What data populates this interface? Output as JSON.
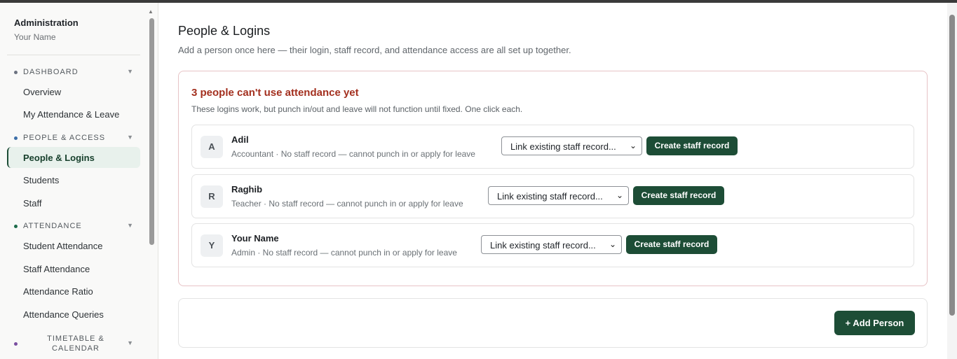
{
  "sidebar": {
    "title": "Administration",
    "user": "Your Name",
    "sections": [
      {
        "label": "DASHBOARD",
        "color": "#6b7280",
        "items": [
          "Overview",
          "My Attendance & Leave"
        ]
      },
      {
        "label": "PEOPLE & ACCESS",
        "color": "#3b6ea8",
        "items": [
          "People & Logins",
          "Students",
          "Staff"
        ]
      },
      {
        "label": "ATTENDANCE",
        "color": "#1d6b4a",
        "items": [
          "Student Attendance",
          "Staff Attendance",
          "Attendance Ratio",
          "Attendance Queries"
        ]
      },
      {
        "label": "TIMETABLE & CALENDAR",
        "color": "#7a4fa0",
        "items": []
      }
    ],
    "active_item": "People & Logins",
    "chevron_icon": "chevron-down-icon"
  },
  "main": {
    "title": "People & Logins",
    "subtitle": "Add a person once here — their login, staff record, and attendance access are all set up together.",
    "alert": {
      "title": "3 people can't use attendance yet",
      "subtitle": "These logins work, but punch in/out and leave will not function until fixed. One click each.",
      "rows": [
        {
          "initial": "A",
          "name": "Adil",
          "desc": "Accountant · No staff record — cannot punch in or apply for leave",
          "select_value": "Link existing staff record...",
          "button": "Create staff record"
        },
        {
          "initial": "R",
          "name": "Raghib",
          "desc": "Teacher · No staff record — cannot punch in or apply for leave",
          "select_value": "Link existing staff record...",
          "button": "Create staff record"
        },
        {
          "initial": "Y",
          "name": "Your Name",
          "desc": "Admin · No staff record — cannot punch in or apply for leave",
          "select_value": "Link existing staff record...",
          "button": "Create staff record"
        }
      ]
    },
    "add_button": "+ Add Person"
  },
  "colors": {
    "accent": "#1d4d36",
    "alert_title": "#a3301f",
    "alert_border": "#e7c3c6"
  }
}
